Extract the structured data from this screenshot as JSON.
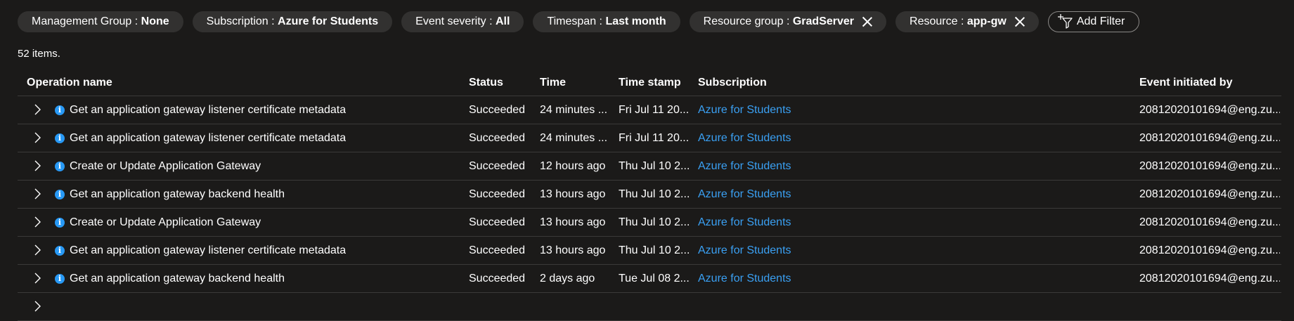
{
  "filters": [
    {
      "label": "Management Group : ",
      "value": "None",
      "closable": false
    },
    {
      "label": "Subscription : ",
      "value": "Azure for Students",
      "closable": false
    },
    {
      "label": "Event severity : ",
      "value": "All",
      "closable": false
    },
    {
      "label": "Timespan : ",
      "value": "Last month",
      "closable": false
    },
    {
      "label": "Resource group : ",
      "value": "GradServer",
      "closable": true
    },
    {
      "label": "Resource : ",
      "value": "app-gw",
      "closable": true
    }
  ],
  "add_filter_label": "Add Filter",
  "item_count": "52 items.",
  "columns": {
    "operation": "Operation name",
    "status": "Status",
    "time": "Time",
    "timestamp": "Time stamp",
    "subscription": "Subscription",
    "initiated_by": "Event initiated by"
  },
  "rows": [
    {
      "operation": "Get an application gateway listener certificate metadata",
      "status": "Succeeded",
      "time": "24 minutes ...",
      "timestamp": "Fri Jul 11 20...",
      "subscription": "Azure for Students",
      "initiated_by": "20812020101694@eng.zu..."
    },
    {
      "operation": "Get an application gateway listener certificate metadata",
      "status": "Succeeded",
      "time": "24 minutes ...",
      "timestamp": "Fri Jul 11 20...",
      "subscription": "Azure for Students",
      "initiated_by": "20812020101694@eng.zu..."
    },
    {
      "operation": "Create or Update Application Gateway",
      "status": "Succeeded",
      "time": "12 hours ago",
      "timestamp": "Thu Jul 10 2...",
      "subscription": "Azure for Students",
      "initiated_by": "20812020101694@eng.zu..."
    },
    {
      "operation": "Get an application gateway backend health",
      "status": "Succeeded",
      "time": "13 hours ago",
      "timestamp": "Thu Jul 10 2...",
      "subscription": "Azure for Students",
      "initiated_by": "20812020101694@eng.zu..."
    },
    {
      "operation": "Create or Update Application Gateway",
      "status": "Succeeded",
      "time": "13 hours ago",
      "timestamp": "Thu Jul 10 2...",
      "subscription": "Azure for Students",
      "initiated_by": "20812020101694@eng.zu..."
    },
    {
      "operation": "Get an application gateway listener certificate metadata",
      "status": "Succeeded",
      "time": "13 hours ago",
      "timestamp": "Thu Jul 10 2...",
      "subscription": "Azure for Students",
      "initiated_by": "20812020101694@eng.zu..."
    },
    {
      "operation": "Get an application gateway backend health",
      "status": "Succeeded",
      "time": "2 days ago",
      "timestamp": "Tue Jul 08 2...",
      "subscription": "Azure for Students",
      "initiated_by": "20812020101694@eng.zu..."
    }
  ],
  "colors": {
    "link": "#3aa0f3",
    "info_icon": "#2899f5",
    "background": "#1b1a19",
    "pill": "#323130"
  }
}
